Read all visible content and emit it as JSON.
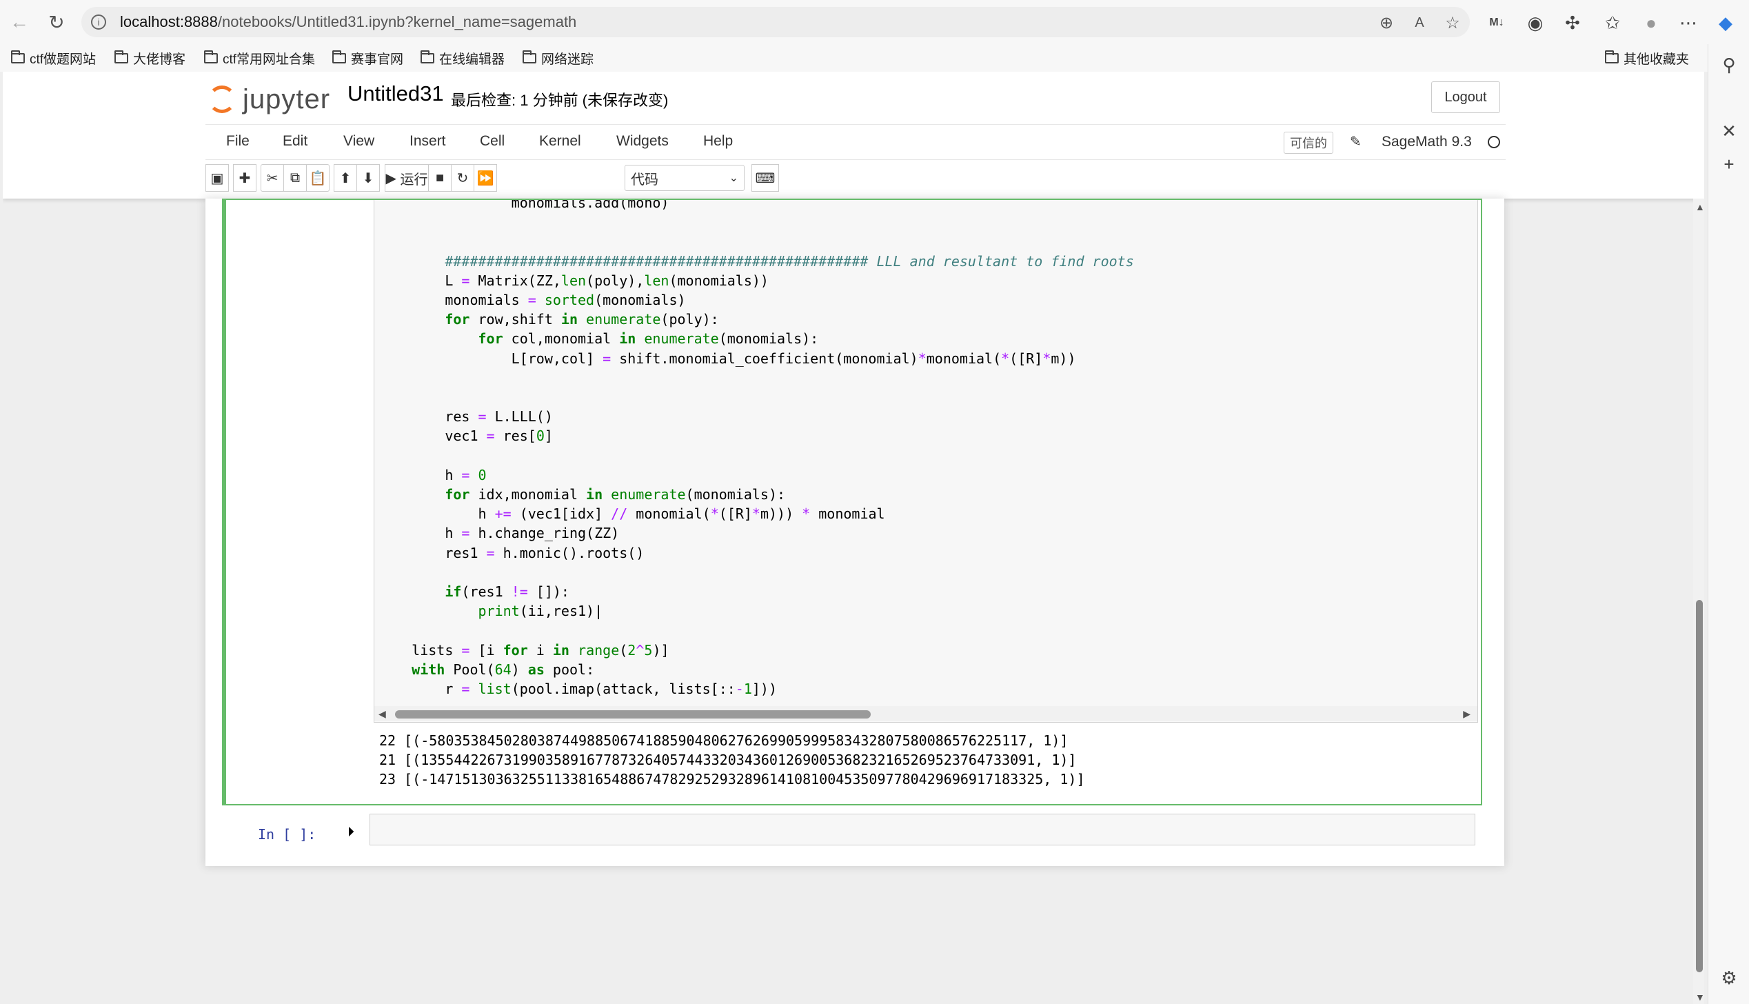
{
  "browser": {
    "url_host": "localhost:8888",
    "url_rest": "/notebooks/Untitled31.ipynb?kernel_name=sagemath",
    "bookmarks": [
      "ctf做题网站",
      "大佬博客",
      "ctf常用网址合集",
      "赛事官网",
      "在线编辑器",
      "网络迷踪"
    ],
    "other_bookmarks": "其他收藏夹"
  },
  "jupyter": {
    "logo_text": "jupyter",
    "notebook_title": "Untitled31",
    "save_status": "最后检查: 1 分钟前  (未保存改变)",
    "logout_label": "Logout",
    "menu": [
      "File",
      "Edit",
      "View",
      "Insert",
      "Cell",
      "Kernel",
      "Widgets",
      "Help"
    ],
    "trusted_label": "可信的",
    "kernel_name": "SageMath 9.3",
    "run_label": "运行",
    "cell_type": "代码"
  },
  "cell1": {
    "output_lines": [
      "22 [(-580353845028038744988506741885904806276269905999583432807580086576225117, 1)]",
      "21 [(1355442267319903589167787326405744332034360126900536823216526952376473309​1, 1)]",
      "23 [(-147151303632551133816548867478292529328961410810045350977804296969171833​25, 1)]"
    ]
  },
  "cell2": {
    "prompt": "In  [ ]:"
  },
  "colors": {
    "cell_selected_border": "#66bb6a",
    "jupyter_orange": "#f37726",
    "prompt_blue": "#303f9f"
  }
}
